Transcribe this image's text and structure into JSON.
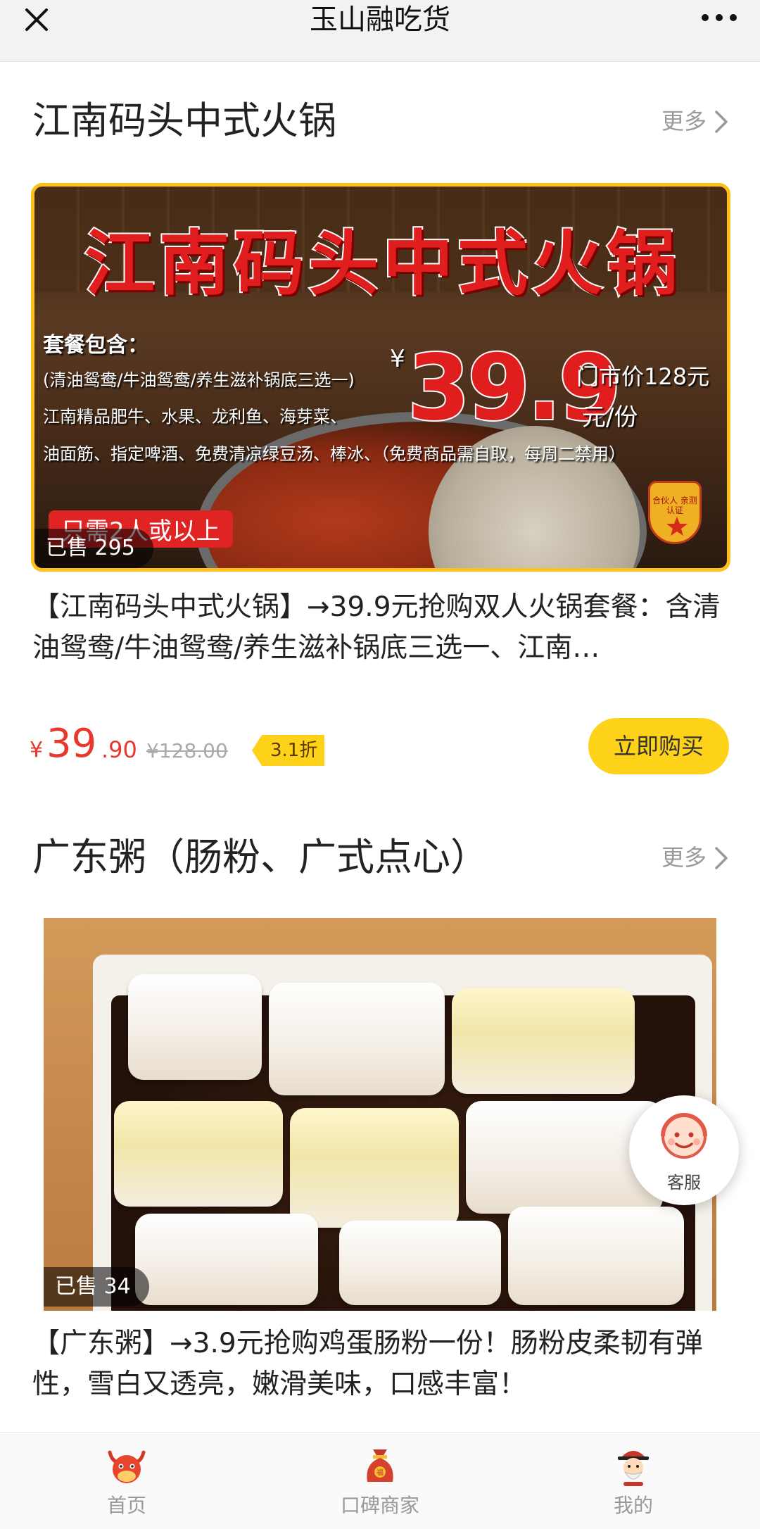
{
  "header": {
    "title": "玉山融吃货"
  },
  "sections": [
    {
      "title": "江南码头中式火锅",
      "more_label": "更多",
      "banner": {
        "headline": "江南码头中式火锅",
        "pack_title": "套餐包含：",
        "pack_lines": [
          "(清油鸳鸯/牛油鸳鸯/养生滋补锅底三选一)",
          "江南精品肥牛、水果、龙利鱼、海芽菜、",
          "油面筋、指定啤酒、免费清凉绿豆汤、棒冰、（免费商品需自取，每周二禁用）"
        ],
        "price_yen": "¥",
        "price": "39.9",
        "store_price": "门市价128元",
        "unit": "元/份",
        "people_note": "只需2人或以上",
        "badge_text": "合伙人 亲测认证"
      },
      "sold": "已售 295",
      "description": "【江南码头中式火锅】→39.9元抢购双人火锅套餐：含清油鸳鸯/牛油鸳鸯/养生滋补锅底三选一、江南…",
      "price": {
        "yen": "¥",
        "integer": "39",
        "decimal": ".90",
        "original": "¥128.00",
        "discount": "3.1折"
      },
      "buy_label": "立即购买"
    },
    {
      "title": "广东粥（肠粉、广式点心）",
      "more_label": "更多",
      "sold": "已售 34",
      "description": "【广东粥】→3.9元抢购鸡蛋肠粉一份！肠粉皮柔韧有弹性，雪白又透亮，嫩滑美味，口感丰富！"
    }
  ],
  "customer_service": {
    "label": "客服"
  },
  "tabbar": [
    {
      "label": "首页",
      "icon": "bull-mascot-icon"
    },
    {
      "label": "口碑商家",
      "icon": "money-bag-icon"
    },
    {
      "label": "我的",
      "icon": "fortune-god-icon"
    }
  ],
  "colors": {
    "accent_yellow": "#ffd21a",
    "price_red": "#e8382c",
    "banner_border": "#ffc01a"
  }
}
